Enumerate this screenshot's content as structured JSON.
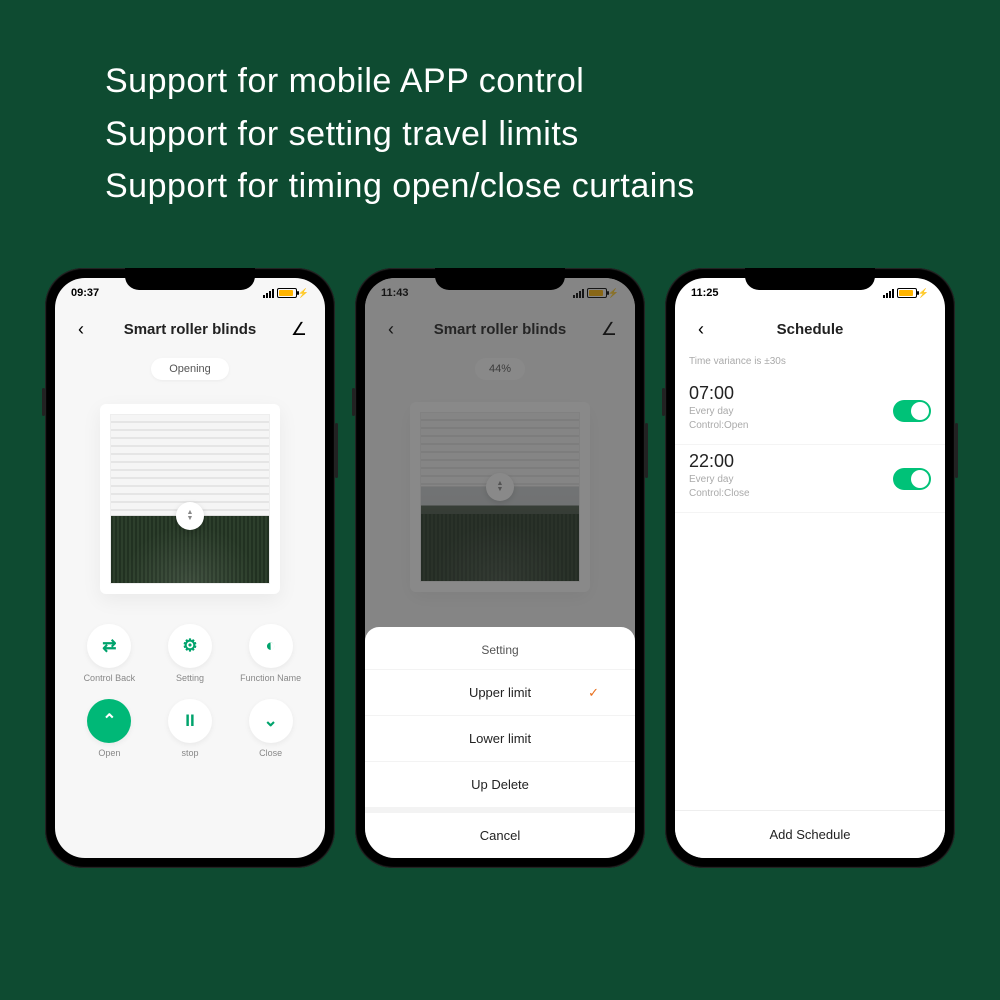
{
  "headlines": [
    "Support for mobile APP control",
    "Support for setting travel limits",
    "Support for timing open/close curtains"
  ],
  "phone1": {
    "clock": "09:37",
    "title": "Smart roller blinds",
    "status_pill": "Opening",
    "controls_top": [
      {
        "icon": "⇄",
        "label": "Control Back"
      },
      {
        "icon": "⚙",
        "label": "Setting"
      },
      {
        "icon": "◐",
        "label": "Function Name"
      }
    ],
    "controls_bottom": [
      {
        "icon": "⌃",
        "label": "Open",
        "primary": true
      },
      {
        "icon": "II",
        "label": "stop",
        "primary": false
      },
      {
        "icon": "⌄",
        "label": "Close",
        "primary": false
      }
    ]
  },
  "phone2": {
    "clock": "11:43",
    "title": "Smart roller blinds",
    "percent": "44%",
    "sheet_title": "Setting",
    "sheet_items": [
      {
        "label": "Upper limit",
        "selected": true
      },
      {
        "label": "Lower limit",
        "selected": false
      },
      {
        "label": "Up Delete",
        "selected": false
      }
    ],
    "sheet_cancel": "Cancel"
  },
  "phone3": {
    "clock": "11:25",
    "title": "Schedule",
    "hint": "Time variance is ±30s",
    "items": [
      {
        "time": "07:00",
        "repeat": "Every day",
        "control": "Control:Open",
        "on": true
      },
      {
        "time": "22:00",
        "repeat": "Every day",
        "control": "Control:Close",
        "on": true
      }
    ],
    "add_label": "Add Schedule"
  }
}
